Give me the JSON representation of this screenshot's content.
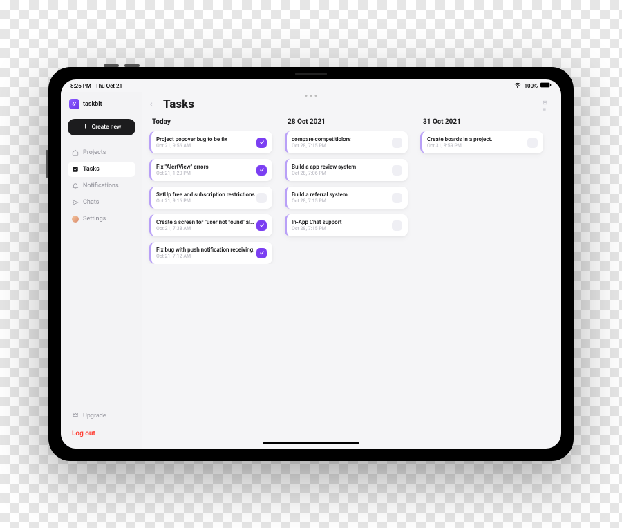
{
  "statusbar": {
    "time": "8:26 PM",
    "date": "Thu Oct 21",
    "wifi_icon": "wifi",
    "battery_text": "100%"
  },
  "brand": {
    "name": "taskbit"
  },
  "create_button": {
    "label": "Create new"
  },
  "nav": {
    "items": [
      {
        "key": "projects",
        "label": "Projects",
        "icon": "home-icon"
      },
      {
        "key": "tasks",
        "label": "Tasks",
        "icon": "check-square-icon",
        "active": true
      },
      {
        "key": "notifications",
        "label": "Notifications",
        "icon": "bell-icon"
      },
      {
        "key": "chats",
        "label": "Chats",
        "icon": "send-icon"
      },
      {
        "key": "settings",
        "label": "Settings",
        "icon": "avatar-icon"
      }
    ]
  },
  "upgrade": {
    "label": "Upgrade"
  },
  "logout": {
    "label": "Log out"
  },
  "page": {
    "title": "Tasks"
  },
  "columns": [
    {
      "title": "Today",
      "tasks": [
        {
          "title": "Project popover bug to be fix",
          "date": "Oct 21, 9:56 AM",
          "done": true
        },
        {
          "title": "Fix \"AlertView\" errors",
          "date": "Oct 21, 1:20 PM",
          "done": true
        },
        {
          "title": "SetUp free and subscription restrictions",
          "date": "Oct 21, 9:16 PM",
          "done": false
        },
        {
          "title": "Create a screen for \"user not found\" alert e…",
          "date": "Oct 21, 7:38 AM",
          "done": true
        },
        {
          "title": "Fix bug with push notification receiving.",
          "date": "Oct 21, 7:12 AM",
          "done": true
        }
      ]
    },
    {
      "title": "28 Oct 2021",
      "tasks": [
        {
          "title": "compare competitioiors",
          "date": "Oct 28, 7:15 PM",
          "done": false
        },
        {
          "title": "Build a app review system",
          "date": "Oct 28, 7:06 PM",
          "done": false
        },
        {
          "title": "Build a referral system.",
          "date": "Oct 28, 7:15 PM",
          "done": false
        },
        {
          "title": "In-App Chat support",
          "date": "Oct 28, 7:15 PM",
          "done": false
        }
      ]
    },
    {
      "title": "31 Oct 2021",
      "tasks": [
        {
          "title": "Create boards in a project.",
          "date": "Oct 31, 8:59 PM",
          "done": false
        }
      ]
    }
  ],
  "colors": {
    "accent": "#7b3ff2",
    "danger": "#ff3b30"
  }
}
